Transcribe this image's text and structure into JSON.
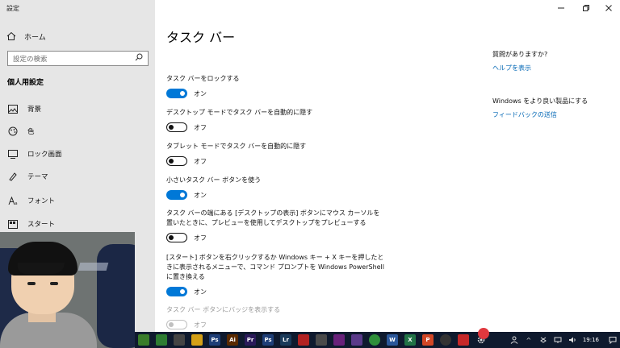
{
  "app": {
    "title": "設定"
  },
  "sidebar": {
    "home_label": "ホーム",
    "search_placeholder": "設定の検索",
    "section_label": "個人用設定",
    "items": [
      {
        "label": "背景",
        "icon": "image-icon"
      },
      {
        "label": "色",
        "icon": "palette-icon"
      },
      {
        "label": "ロック画面",
        "icon": "lock-screen-icon"
      },
      {
        "label": "テーマ",
        "icon": "theme-icon"
      },
      {
        "label": "フォント",
        "icon": "font-icon"
      },
      {
        "label": "スタート",
        "icon": "start-icon"
      }
    ]
  },
  "main": {
    "title": "タスク バー",
    "settings": [
      {
        "label": "タスク バーをロックする",
        "state": "オン",
        "on": true
      },
      {
        "label": "デスクトップ モードでタスク バーを自動的に隠す",
        "state": "オフ",
        "on": false
      },
      {
        "label": "タブレット モードでタスク バーを自動的に隠す",
        "state": "オフ",
        "on": false
      },
      {
        "label": "小さいタスク バー ボタンを使う",
        "state": "オン",
        "on": true
      },
      {
        "label": "タスク バーの端にある [デスクトップの表示] ボタンにマウス カーソルを置いたときに、プレビューを使用してデスクトップをプレビューする",
        "state": "オフ",
        "on": false
      },
      {
        "label": "[スタート] ボタンを右クリックするか Windows キー + X キーを押したときに表示されるメニューで、コマンド プロンプトを Windows PowerShell に置き換える",
        "state": "オン",
        "on": true
      },
      {
        "label": "タスク バー ボタンにバッジを表示する",
        "state": "オフ",
        "on": false,
        "disabled": true
      }
    ]
  },
  "help": {
    "question": "質問がありますか?",
    "help_link": "ヘルプを表示",
    "improve": "Windows をより良い製品にする",
    "feedback_link": "フィードバックの送信"
  },
  "taskbar": {
    "clock": "19:16",
    "accent": "#0078d7",
    "apps": [
      {
        "name": "green-app-icon",
        "color": "#3a7d2a",
        "glyph": ""
      },
      {
        "name": "terminal-icon",
        "color": "#2e7d32",
        "glyph": ""
      },
      {
        "name": "circle-app-icon",
        "color": "#444444",
        "glyph": ""
      },
      {
        "name": "waveform-icon",
        "color": "#d4a017",
        "glyph": ""
      },
      {
        "name": "photoshop-icon",
        "color": "#1f3f78",
        "glyph": "Ps"
      },
      {
        "name": "illustrator-icon",
        "color": "#5a2a00",
        "glyph": "Ai"
      },
      {
        "name": "premiere-icon",
        "color": "#2a1a5a",
        "glyph": "Pr"
      },
      {
        "name": "photoshop-icon-2",
        "color": "#1f3f78",
        "glyph": "Ps"
      },
      {
        "name": "lightroom-icon",
        "color": "#1a3a5a",
        "glyph": "Lr"
      },
      {
        "name": "filezilla-icon",
        "color": "#b22222",
        "glyph": ""
      },
      {
        "name": "game-app-icon",
        "color": "#4a4a4a",
        "glyph": ""
      },
      {
        "name": "visual-studio-icon",
        "color": "#68217a",
        "glyph": ""
      },
      {
        "name": "edit-app-icon",
        "color": "#5a3a8a",
        "glyph": ""
      },
      {
        "name": "chrome-icon",
        "color": "#2f8f3a",
        "glyph": ""
      },
      {
        "name": "word-icon",
        "color": "#2b579a",
        "glyph": "W"
      },
      {
        "name": "excel-icon",
        "color": "#217346",
        "glyph": "X"
      },
      {
        "name": "powerpoint-icon",
        "color": "#d24726",
        "glyph": "P"
      },
      {
        "name": "obs-icon",
        "color": "#333333",
        "glyph": ""
      },
      {
        "name": "red-app-icon",
        "color": "#c62828",
        "glyph": ""
      },
      {
        "name": "settings-gear-icon",
        "color": "#0f1a2e",
        "glyph": ""
      }
    ]
  }
}
